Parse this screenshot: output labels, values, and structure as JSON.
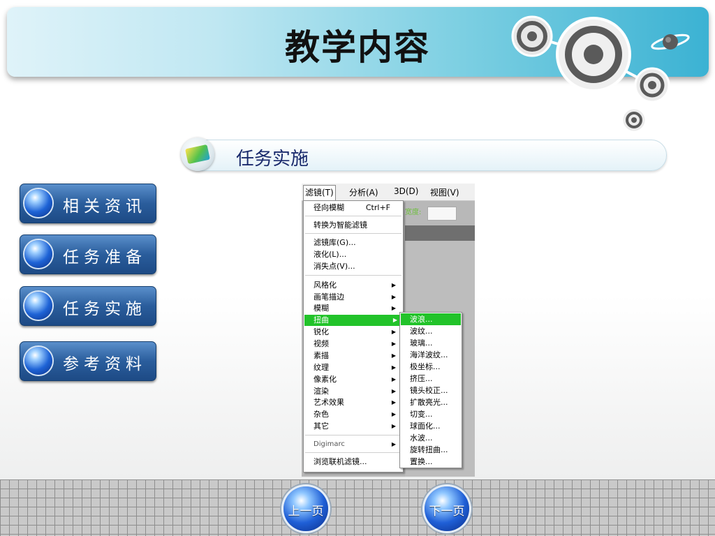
{
  "header": {
    "title": "教学内容"
  },
  "section": {
    "title": "任务实施"
  },
  "sidebar": {
    "items": [
      {
        "label": "相关资讯"
      },
      {
        "label": "任务准备"
      },
      {
        "label": "任务实施"
      },
      {
        "label": "参考资料"
      }
    ]
  },
  "screenshot": {
    "menubar": [
      "滤镜(T)",
      "分析(A)",
      "3D(D)",
      "视图(V)"
    ],
    "background_label": "宽度:",
    "filter_menu": {
      "top_item": {
        "label": "径向模糊",
        "shortcut": "Ctrl+F"
      },
      "convert": "转换为智能滤镜",
      "group1": [
        "滤镜库(G)...",
        "液化(L)...",
        "消失点(V)..."
      ],
      "group2": [
        "风格化",
        "画笔描边",
        "模糊",
        "扭曲",
        "锐化",
        "视频",
        "素描",
        "纹理",
        "像素化",
        "渲染",
        "艺术效果",
        "杂色",
        "其它"
      ],
      "highlighted": "扭曲",
      "digimarc": "Digimarc",
      "browse": "浏览联机滤镜..."
    },
    "distort_submenu": [
      "波浪...",
      "波纹...",
      "玻璃...",
      "海洋波纹...",
      "极坐标...",
      "挤压...",
      "镜头校正...",
      "扩散亮光...",
      "切变...",
      "球面化...",
      "水波...",
      "旋转扭曲...",
      "置换..."
    ],
    "submenu_highlighted": "波浪..."
  },
  "footer": {
    "prev_label": "上一页",
    "next_label": "下一页"
  },
  "colors": {
    "nav_blue": "#2a5d9c",
    "menu_highlight": "#22c32a",
    "section_text": "#1a2a6c"
  },
  "icons": {
    "decoration": "target-circles-icon",
    "planet": "planet-icon",
    "section": "picture-icon",
    "nav_ball": "blue-orb-icon"
  }
}
